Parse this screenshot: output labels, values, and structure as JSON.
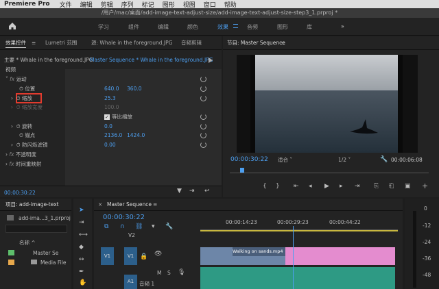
{
  "menubar": {
    "app": "Premiere Pro",
    "items": [
      "文件",
      "编辑",
      "剪辑",
      "序列",
      "标记",
      "图形",
      "视图",
      "窗口",
      "帮助"
    ]
  },
  "titlebar": {
    "path": "/用户/mac/桌面/add-image-text-adjust-size/add-image-text-adjust-size-step3_1.prproj *"
  },
  "workspaces": {
    "items": [
      "学习",
      "组件",
      "编辑",
      "颜色",
      "效果",
      "音频",
      "图形",
      "库"
    ],
    "active": "效果",
    "more": "»"
  },
  "effects": {
    "tabs": [
      "效果控件",
      "Lumetri 范围",
      "源: Whale in the foreground.JPG",
      "音频剪辑"
    ],
    "master": "主要 * Whale in the foreground.JPG",
    "sequence": "Master Sequence * Whale in the foreground.JPG",
    "section_video": "视频",
    "motion": "运动",
    "position_label": "位置",
    "position_x": "640.0",
    "position_y": "360.0",
    "scale_label": "缩放",
    "scale_value": "25.3",
    "scale_width_label": "缩放宽度",
    "scale_width_value": "100.0",
    "uniform_label": "等比缩放",
    "rotation_label": "旋转",
    "rotation_value": "0.0",
    "anchor_label": "锚点",
    "anchor_x": "2136.0",
    "anchor_y": "1424.0",
    "flicker_label": "防闪烁滤镜",
    "flicker_value": "0.00",
    "opacity_label": "不透明度",
    "remap_label": "时间重映射",
    "timecode": "00:00:30:22"
  },
  "program": {
    "title": "节目: Master Sequence",
    "timecode": "00:00:30:22",
    "fit": "适合",
    "res": "1/2",
    "duration": "00:00:06:08"
  },
  "project": {
    "title": "项目: add-image-text",
    "file": "add-ima...3_1.prproj",
    "col_name": "名称",
    "items": [
      "Master Se",
      "Media File"
    ]
  },
  "timeline": {
    "title": "Master Sequence",
    "timecode": "00:00:30:22",
    "ticks": [
      "00:00:14:23",
      "00:00:29:23",
      "00:00:44:22"
    ],
    "v2": "V2",
    "v1": "V1",
    "a1": "A1",
    "clip_name": "Walking on sands.mp4",
    "audio_label": "音频 1",
    "m": "M",
    "s": "S"
  },
  "meter": {
    "labels": [
      "0",
      "-12",
      "-24",
      "-36",
      "-48"
    ]
  }
}
